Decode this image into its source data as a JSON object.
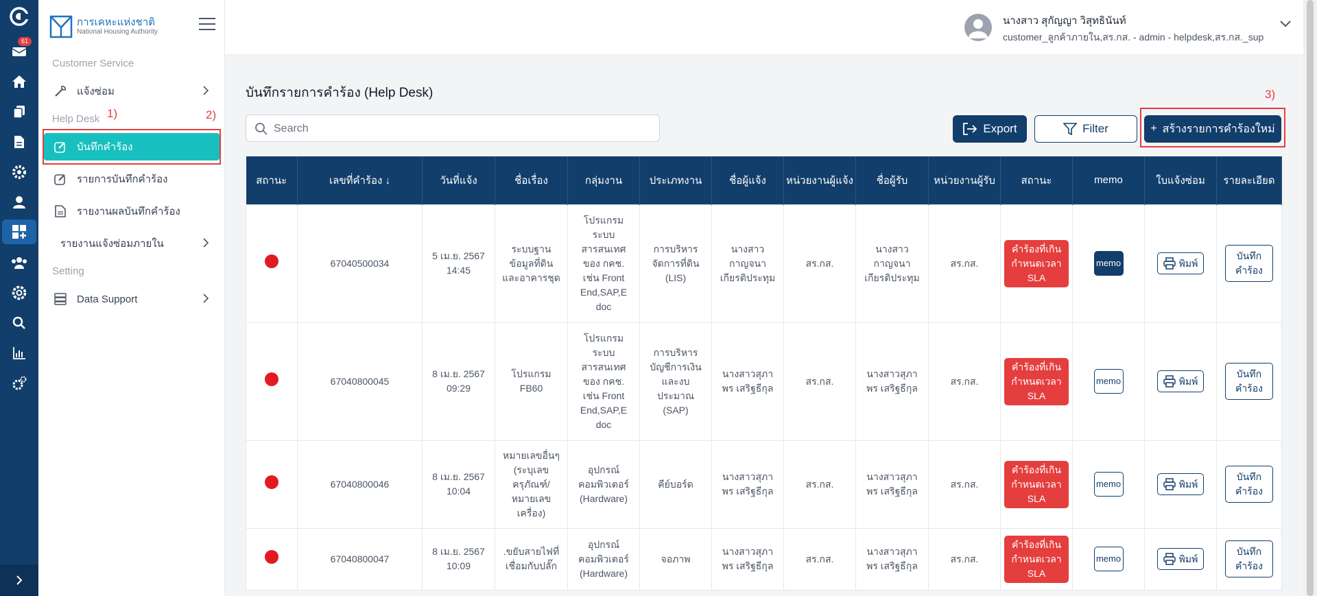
{
  "rail": {
    "mail_badge": "61",
    "icons": [
      "brand-logo-icon",
      "mail-icon",
      "home-icon",
      "copy-icon",
      "document-icon",
      "settings-gear-icon",
      "user-icon",
      "apps-grid-icon",
      "group-icon",
      "settings-cog-icon",
      "search-icon",
      "bar-chart-icon",
      "admin-gears-icon"
    ],
    "colors": {
      "bg": "#123e6b",
      "active": "#1e63a8"
    }
  },
  "sidebar": {
    "logo_th": "การเคหะแห่งชาติ",
    "logo_en": "National Housing Authority",
    "customer_service_heading": "Customer Service",
    "repair_label": "แจ้งซ่อม",
    "helpdesk_heading": "Help Desk",
    "record_request_label": "บันทึกคำร้อง",
    "request_list_label": "รายการบันทึกคำร้อง",
    "report_label": "รายงานผลบันทึกคำร้อง",
    "internal_repair_report_label": "รายงานแจ้งซ่อมภายใน",
    "setting_heading": "Setting",
    "data_support_label": "Data Support",
    "annotations": [
      "1)",
      "2)",
      "3)"
    ]
  },
  "header": {
    "user_name": "นางสาว สุกัญญา วิสุทธินันท์",
    "user_role": "customer_ลูกค้าภายใน,สร.กส. - admin - helpdesk,สร.กส._sup"
  },
  "main": {
    "title": "บันทึกรายการคำร้อง (Help Desk)",
    "search_placeholder": "Search",
    "export_label": "Export",
    "filter_label": "Filter",
    "create_label": "สร้างรายการคำร้องใหม่",
    "create_plus": "+",
    "accent_color": "#123e6b",
    "sla_color": "#e53e3e"
  },
  "table": {
    "headers": [
      "สถานะ",
      "เลขที่คำร้อง ↓",
      "วันที่แจ้ง",
      "ชื่อเรื่อง",
      "กลุ่มงาน",
      "ประเภทงาน",
      "ชื่อผู้แจ้ง",
      "หน่วยงานผู้แจ้ง",
      "ชื่อผู้รับ",
      "หน่วยงานผู้รับ",
      "สถานะ",
      "memo",
      "ใบแจ้งซ่อม",
      "รายละเอียด"
    ],
    "rows": [
      {
        "req_no": "67040500034",
        "date": "5 เม.ย. 2567\n14:45",
        "subject": "ระบบฐาน\nข้อมูลที่ดิน\nและอาคารชุด",
        "group": "โปรแกรม\nระบบ\nสารสนเทศ\nของ กคช.\nเช่น Front\nEnd,SAP,E\ndoc",
        "type": "การบริหาร\nจัดการที่ดิน\n(LIS)",
        "reporter": "นางสาว\nกาญจนา\nเกียรติประทุม",
        "reporter_unit": "สร.กส.",
        "receiver": "นางสาว\nกาญจนา\nเกียรติประทุม",
        "receiver_unit": "สร.กส.",
        "status": "คำร้องที่เกิน\nกำหนดเวลา\nSLA",
        "memo": "memo",
        "print": "พิมพ์",
        "detail": "บันทึก\nคำร้อง"
      },
      {
        "req_no": "67040800045",
        "date": "8 เม.ย. 2567\n09:29",
        "subject": "โปรแกรม\nFB60",
        "group": "โปรแกรม\nระบบ\nสารสนเทศ\nของ กคช.\nเช่น Front\nEnd,SAP,E\ndoc",
        "type": "การบริหาร\nบัญชีการเงิน\nและงบ\nประมาณ\n(SAP)",
        "reporter": "นางสาวสุภา\nพร เสริฐธีกุล",
        "reporter_unit": "สร.กส.",
        "receiver": "นางสาวสุภา\nพร เสริฐธีกุล",
        "receiver_unit": "สร.กส.",
        "status": "คำร้องที่เกิน\nกำหนดเวลา\nSLA",
        "memo": "memo",
        "print": "พิมพ์",
        "detail": "บันทึก\nคำร้อง"
      },
      {
        "req_no": "67040800046",
        "date": "8 เม.ย. 2567\n10:04",
        "subject": "หมายเลขอื่นๆ\n(ระบุเลข\nครุภัณฑ์/\nหมายเลข\nเครื่อง)",
        "group": "อุปกรณ์\nคอมพิวเตอร์\n(Hardware)",
        "type": "คีย์บอร์ด",
        "reporter": "นางสาวสุภา\nพร เสริฐธีกุล",
        "reporter_unit": "สร.กส.",
        "receiver": "นางสาวสุภา\nพร เสริฐธีกุล",
        "receiver_unit": "สร.กส.",
        "status": "คำร้องที่เกิน\nกำหนดเวลา\nSLA",
        "memo": "memo",
        "print": "พิมพ์",
        "detail": "บันทึก\nคำร้อง"
      },
      {
        "req_no": "67040800047",
        "date": "8 เม.ย. 2567\n10:09",
        "subject": ".ขยับสายไฟที่\nเชื่อมกับปลั๊ก",
        "group": "อุปกรณ์\nคอมพิวเตอร์\n(Hardware)",
        "type": "จอภาพ",
        "reporter": "นางสาวสุภา\nพร เสริฐธีกุล",
        "reporter_unit": "สร.กส.",
        "receiver": "นางสาวสุภา\nพร เสริฐธีกุล",
        "receiver_unit": "สร.กส.",
        "status": "คำร้องที่เกิน\nกำหนดเวลา\nSLA",
        "memo": "memo",
        "print": "พิมพ์",
        "detail": "บันทึก\nคำร้อง"
      }
    ]
  }
}
